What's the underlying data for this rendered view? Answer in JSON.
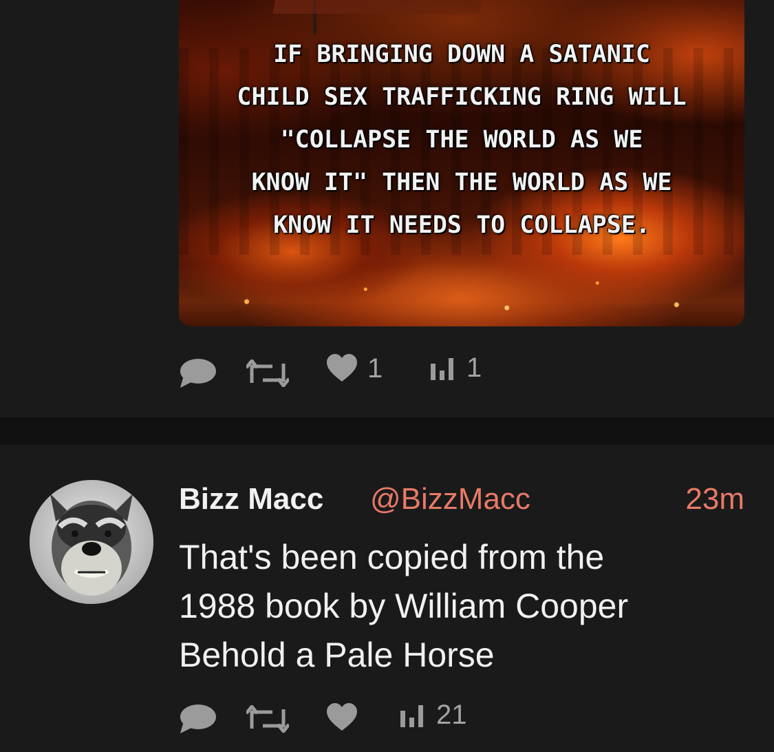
{
  "theme": {
    "background": "#1a1a1a",
    "divider": "#111111",
    "text": "#f1f1f1",
    "muted": "#9b9b9b",
    "accent": "#e87a67"
  },
  "top_post": {
    "media": {
      "text": "IF BRINGING DOWN A SATANIC\nCHILD SEX TRAFFICKING RING WILL\n\"COLLAPSE THE WORLD AS WE\nKNOW IT\" THEN THE WORLD AS WE\nKNOW IT NEEDS TO COLLAPSE."
    },
    "actions": {
      "reply_icon": "speech-bubble-icon",
      "repost_icon": "repost-icon",
      "like_icon": "heart-icon",
      "like_count": "1",
      "stats_icon": "bar-chart-icon",
      "view_count": "1"
    }
  },
  "reply_post": {
    "author": {
      "display_name": "Bizz Macc",
      "handle": "@BizzMacc",
      "avatar_icon": "schnauzer-avatar"
    },
    "timestamp": "23m",
    "text": "That's been copied from the\n1988 book by William Cooper\nBehold a Pale Horse",
    "actions": {
      "reply_icon": "speech-bubble-icon",
      "repost_icon": "repost-icon",
      "like_icon": "heart-icon",
      "stats_icon": "bar-chart-icon",
      "view_count": "21"
    }
  }
}
